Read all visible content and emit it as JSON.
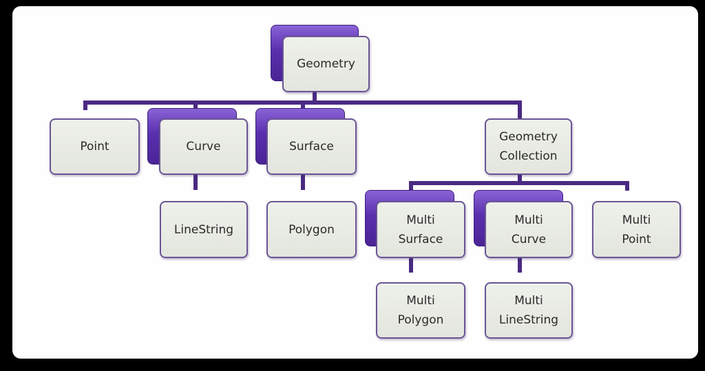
{
  "diagram": {
    "type": "hierarchy",
    "colors": {
      "connector": "#4a2a82",
      "node_fill": "#e8eae4",
      "node_border": "#6a5594",
      "abstract_shadow": "#5a2fae",
      "background": "#fefefe",
      "frame": "#000000"
    },
    "nodes": {
      "geometry": {
        "lines": [
          "Geometry"
        ],
        "abstract": true
      },
      "point": {
        "lines": [
          "Point"
        ],
        "abstract": false
      },
      "curve": {
        "lines": [
          "Curve"
        ],
        "abstract": true
      },
      "surface": {
        "lines": [
          "Surface"
        ],
        "abstract": true
      },
      "geometry_collection": {
        "lines": [
          "Geometry",
          "Collection"
        ],
        "abstract": false
      },
      "linestring": {
        "lines": [
          "LineString"
        ],
        "abstract": false
      },
      "polygon": {
        "lines": [
          "Polygon"
        ],
        "abstract": false
      },
      "multi_surface": {
        "lines": [
          "Multi",
          "Surface"
        ],
        "abstract": true
      },
      "multi_curve": {
        "lines": [
          "Multi",
          "Curve"
        ],
        "abstract": true
      },
      "multi_point": {
        "lines": [
          "Multi",
          "Point"
        ],
        "abstract": false
      },
      "multi_polygon": {
        "lines": [
          "Multi",
          "Polygon"
        ],
        "abstract": false
      },
      "multi_linestring": {
        "lines": [
          "Multi",
          "LineString"
        ],
        "abstract": false
      }
    },
    "edges": [
      [
        "geometry",
        "point"
      ],
      [
        "geometry",
        "curve"
      ],
      [
        "geometry",
        "surface"
      ],
      [
        "geometry",
        "geometry_collection"
      ],
      [
        "curve",
        "linestring"
      ],
      [
        "surface",
        "polygon"
      ],
      [
        "geometry_collection",
        "multi_surface"
      ],
      [
        "geometry_collection",
        "multi_curve"
      ],
      [
        "geometry_collection",
        "multi_point"
      ],
      [
        "multi_surface",
        "multi_polygon"
      ],
      [
        "multi_curve",
        "multi_linestring"
      ]
    ]
  }
}
